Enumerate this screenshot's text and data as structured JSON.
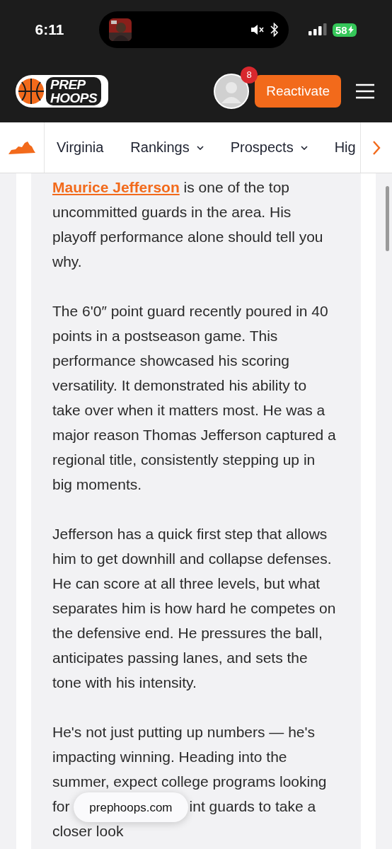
{
  "status_bar": {
    "time": "6:11",
    "battery": "58"
  },
  "header": {
    "logo_lines": [
      "PREP",
      "HOOPS"
    ],
    "notification_count": "8",
    "action_button": "Reactivate"
  },
  "nav": {
    "items": [
      {
        "label": "Virginia",
        "dropdown": false
      },
      {
        "label": "Rankings",
        "dropdown": true
      },
      {
        "label": "Prospects",
        "dropdown": true
      },
      {
        "label": "Hig",
        "dropdown": false
      }
    ]
  },
  "article": {
    "paragraphs": [
      {
        "segments": [
          {
            "kind": "link",
            "text": "Maurice Jefferson"
          },
          {
            "kind": "text",
            "text": " is one of the top uncommitted guards in the area. His playoff performance alone should tell you why."
          }
        ]
      },
      {
        "segments": [
          {
            "kind": "text",
            "text": "The 6'0″ point guard recently poured in 40 points in a postseason game. This performance showcased his scoring versatility. It demonstrated his ability to take over when it matters most. He was a major reason Thomas Jefferson captured a regional title, consistently stepping up in big moments."
          }
        ]
      },
      {
        "segments": [
          {
            "kind": "text",
            "text": "Jefferson has a quick first step that allows him to get downhill and collapse defenses. He can score at all three levels, but what separates him is how hard he competes on the defensive end. He pressures the ball, anticipates passing lanes, and sets the tone with his intensity."
          }
        ]
      },
      {
        "segments": [
          {
            "kind": "text",
            "text": "He's not just putting up numbers — he's impacting winning. Heading into the summer, expect college programs looking for "
          },
          {
            "kind": "overlay",
            "text": "prephoops.com"
          },
          {
            "kind": "text",
            "text": "int guards to take a closer look"
          }
        ]
      }
    ]
  }
}
